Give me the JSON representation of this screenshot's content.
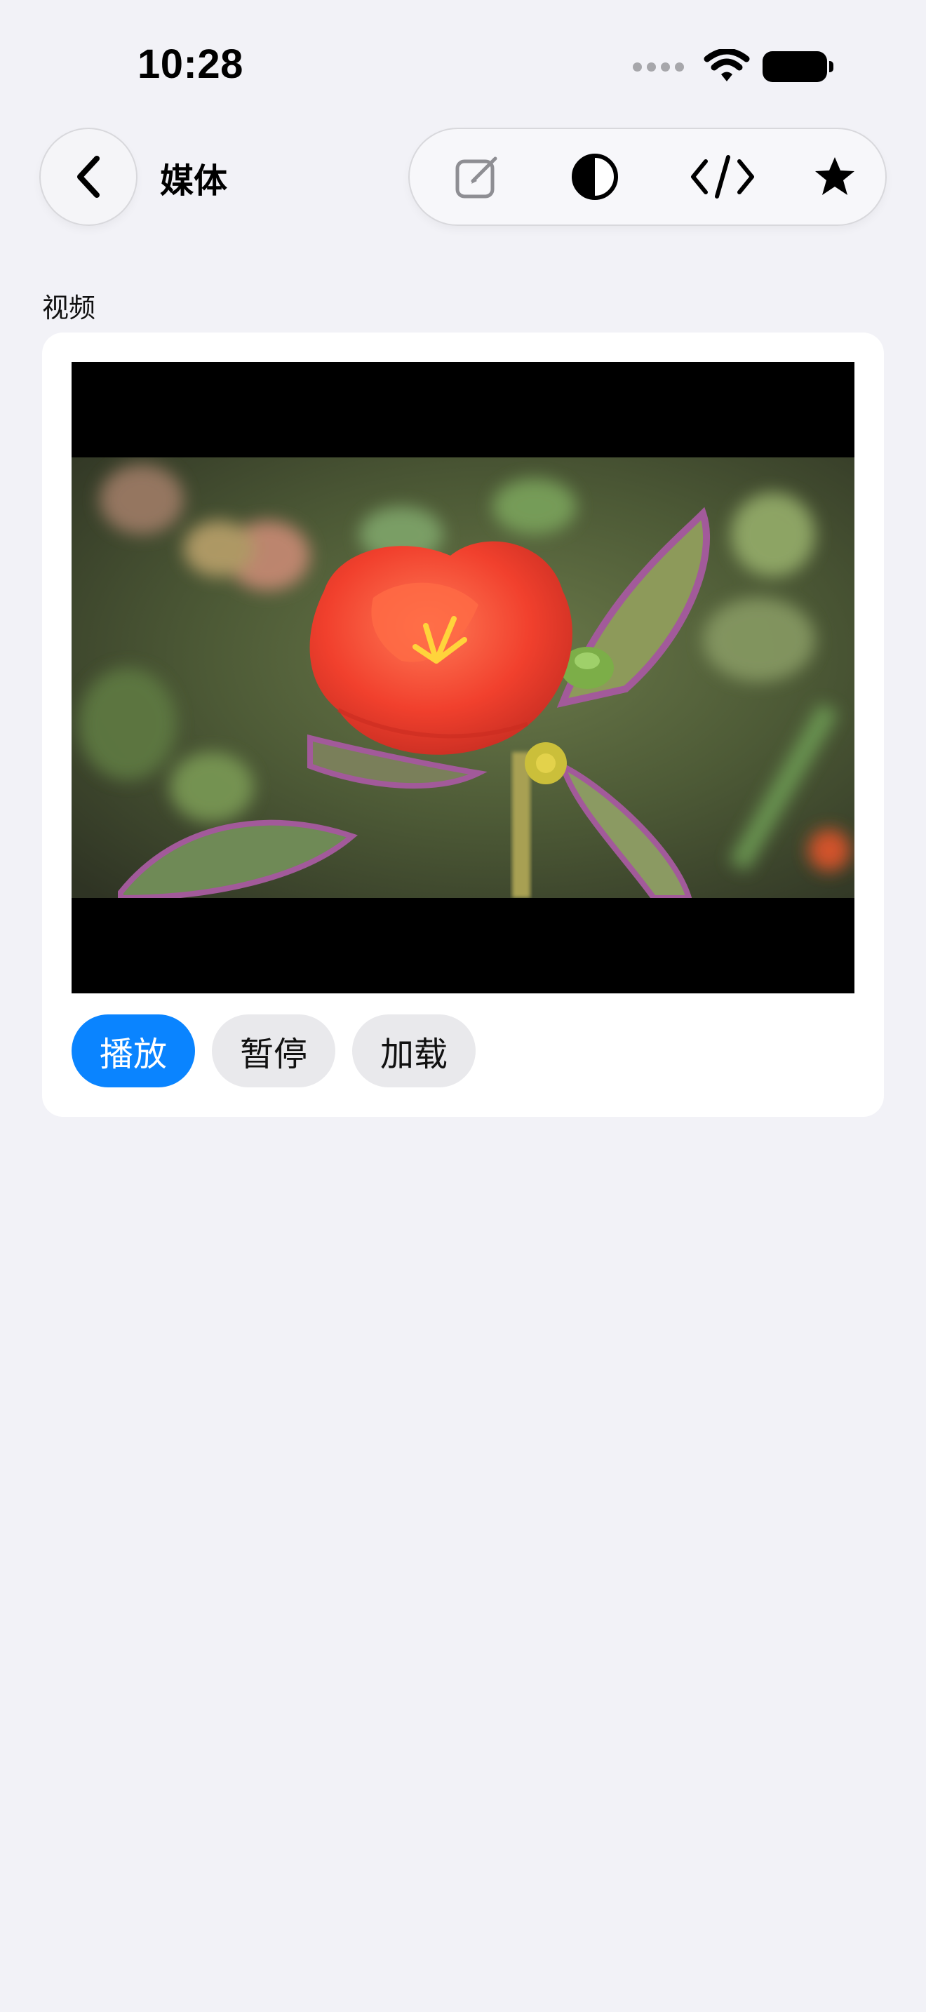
{
  "status_bar": {
    "time": "10:28"
  },
  "nav": {
    "title": "媒体",
    "icons": [
      "chevron-left-icon",
      "edit-icon",
      "contrast-icon",
      "code-icon",
      "star-icon"
    ]
  },
  "section": {
    "label": "视频"
  },
  "buttons": {
    "play": "播放",
    "pause": "暂停",
    "load": "加载"
  },
  "colors": {
    "accent": "#0a84ff",
    "background": "#f2f2f7"
  }
}
